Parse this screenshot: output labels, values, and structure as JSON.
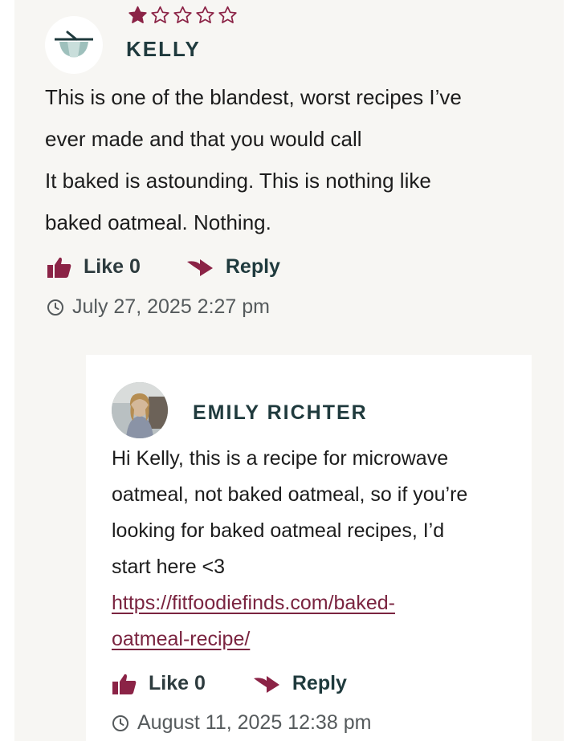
{
  "colors": {
    "accent": "#8b2346",
    "author": "#1f3a3d",
    "card_bg": "#f7f6f3",
    "reply_bg": "#ffffff"
  },
  "comment": {
    "rating": 1,
    "rating_max": 5,
    "author": "KELLY",
    "body_lines": [
      "This is one of the blandest, worst recipes I’ve",
      "ever made and that you would call",
      "It baked is astounding. This is nothing like",
      "baked oatmeal. Nothing."
    ],
    "like_label": "Like 0",
    "reply_label": "Reply",
    "date": "July 27, 2025 2:27 pm"
  },
  "reply": {
    "author": "EMILY RICHTER",
    "body_lines": [
      "Hi Kelly, this is a recipe for microwave",
      "oatmeal, not baked oatmeal, so if you’re",
      "looking for baked oatmeal recipes, I’d",
      "start here <3"
    ],
    "link_lines": [
      "https://fitfoodiefinds.com/baked-",
      "oatmeal-recipe/"
    ],
    "like_label": "Like 0",
    "reply_label": "Reply",
    "date": "August 11, 2025 12:38 pm"
  },
  "icons": {
    "star": "star-icon",
    "like": "thumbs-up-icon",
    "reply": "reply-arrow-icon",
    "clock": "clock-icon",
    "bowl": "bowl-icon"
  }
}
